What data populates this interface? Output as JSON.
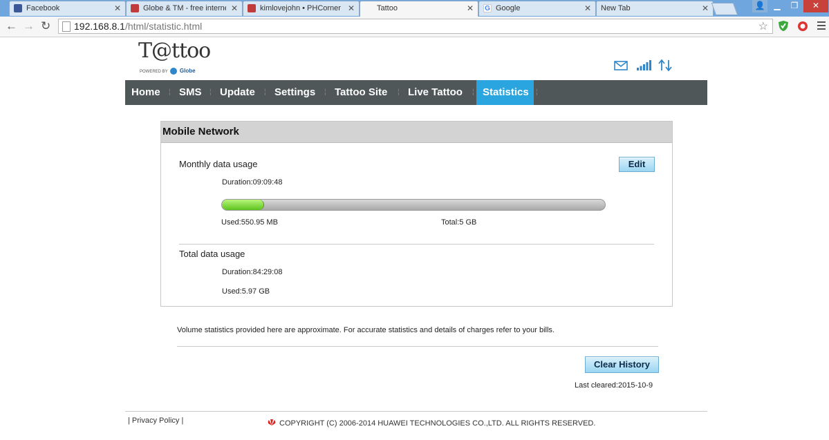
{
  "browser": {
    "tabs": [
      {
        "title": "Facebook",
        "favicon": "facebook-icon",
        "active": false
      },
      {
        "title": "Globe & TM - free interne",
        "favicon": "phcorner-icon",
        "active": false
      },
      {
        "title": "kimlovejohn • PHCorner C",
        "favicon": "phcorner-icon",
        "active": false
      },
      {
        "title": "Tattoo",
        "favicon": "none",
        "active": true
      },
      {
        "title": "Google",
        "favicon": "google-icon",
        "active": false
      },
      {
        "title": "New Tab",
        "favicon": "none",
        "active": false
      }
    ],
    "url_host": "192.168.8.1",
    "url_path": "/html/statistic.html"
  },
  "header": {
    "brand": "T@ttoo",
    "powered_by": "POWERED BY",
    "partner": "Globe"
  },
  "nav": {
    "items": [
      "Home",
      "SMS",
      "Update",
      "Settings",
      "Tattoo Site",
      "Live Tattoo",
      "Statistics"
    ],
    "active": "Statistics"
  },
  "panel": {
    "title": "Mobile Network",
    "monthly": {
      "label": "Monthly data usage",
      "edit_label": "Edit",
      "duration": "Duration:09:09:48",
      "used": "Used:550.95 MB",
      "total": "Total:5 GB",
      "usage_fraction": 0.108
    },
    "total": {
      "label": "Total data usage",
      "duration": "Duration:84:29:08",
      "used": "Used:5.97 GB"
    }
  },
  "notice": "Volume statistics provided here are approximate. For accurate statistics and details of charges refer to your bills.",
  "clear_history_label": "Clear History",
  "last_cleared": "Last cleared:2015-10-9",
  "footer": {
    "privacy": "Privacy Policy",
    "copyright": "COPYRIGHT (C) 2006-2014 HUAWEI TECHNOLOGIES CO.,LTD. ALL RIGHTS RESERVED."
  },
  "colors": {
    "nav_bg": "#505759",
    "nav_active": "#2aa5df",
    "progress_fill": "#5cc41f",
    "accent": "#2f86c8"
  }
}
